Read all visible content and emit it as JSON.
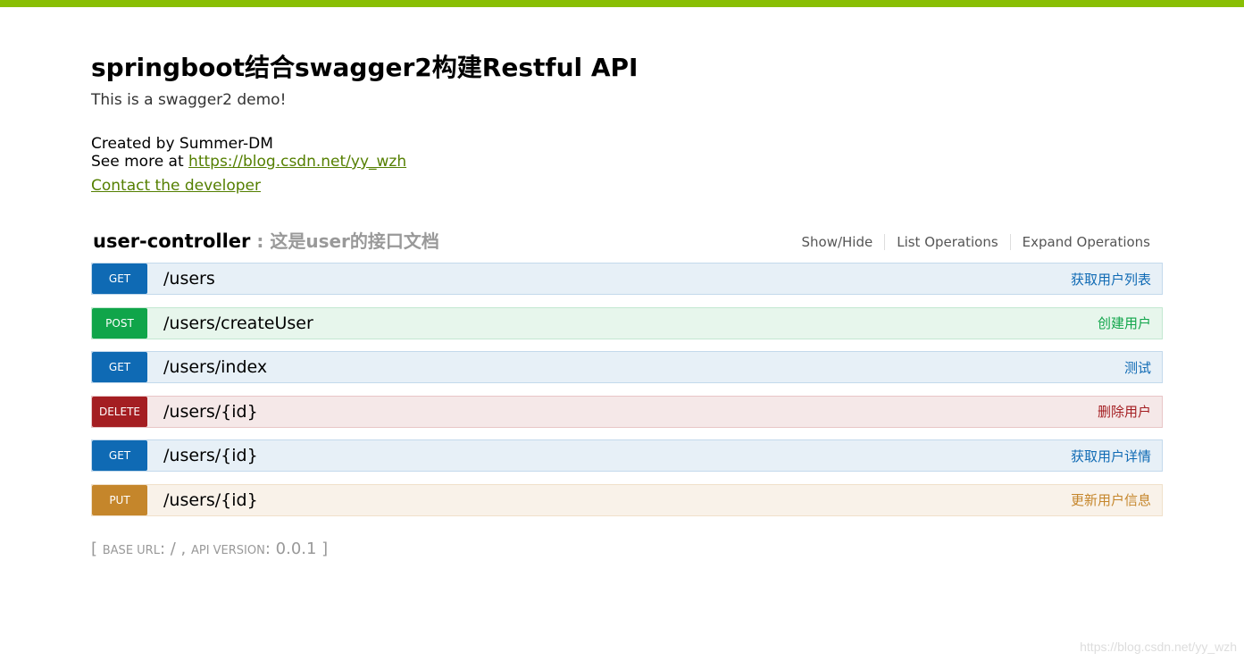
{
  "header": {
    "title": "springboot结合swagger2构建Restful API",
    "description": "This is a swagger2 demo!",
    "created_by": "Created by Summer-DM",
    "see_more_prefix": "See more at ",
    "see_more_link": "https://blog.csdn.net/yy_wzh",
    "contact_label": "Contact the developer"
  },
  "controller": {
    "name": "user-controller",
    "description": " : 这是user的接口文档",
    "links": {
      "show_hide": "Show/Hide",
      "list_operations": "List Operations",
      "expand_operations": "Expand Operations"
    }
  },
  "operations": [
    {
      "method": "GET",
      "path": "/users",
      "summary": "获取用户列表"
    },
    {
      "method": "POST",
      "path": "/users/createUser",
      "summary": "创建用户"
    },
    {
      "method": "GET",
      "path": "/users/index",
      "summary": "测试"
    },
    {
      "method": "DELETE",
      "path": "/users/{id}",
      "summary": "删除用户"
    },
    {
      "method": "GET",
      "path": "/users/{id}",
      "summary": "获取用户详情"
    },
    {
      "method": "PUT",
      "path": "/users/{id}",
      "summary": "更新用户信息"
    }
  ],
  "footer": {
    "open_bracket": "[ ",
    "base_url_label": "base url",
    "base_url_value": ": / , ",
    "api_version_label": "api version",
    "api_version_value": ": 0.0.1 ]"
  },
  "watermark": "https://blog.csdn.net/yy_wzh",
  "colors": {
    "topbar": "#89bf04",
    "get": "#0f6ab4",
    "post": "#10a54a",
    "delete": "#a41e22",
    "put": "#c5862b",
    "link": "#547f00"
  }
}
